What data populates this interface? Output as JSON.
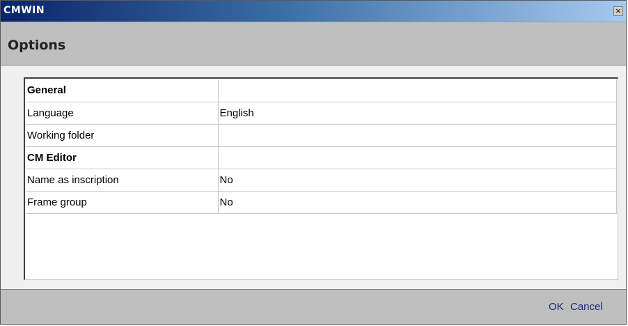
{
  "window": {
    "title": "CMWIN",
    "close_glyph": "×"
  },
  "header": {
    "title": "Options"
  },
  "grid": {
    "rows": [
      {
        "name": "General",
        "value": "",
        "section": true
      },
      {
        "name": "Language",
        "value": "English",
        "section": false
      },
      {
        "name": "Working folder",
        "value": "",
        "section": false
      },
      {
        "name": "CM Editor",
        "value": "",
        "section": true
      },
      {
        "name": "Name as inscription",
        "value": "No",
        "section": false
      },
      {
        "name": "Frame group",
        "value": "No",
        "section": false
      }
    ]
  },
  "footer": {
    "ok_label": "OK",
    "cancel_label": "Cancel"
  },
  "colors": {
    "titlebar_start": "#0a246a",
    "titlebar_end": "#a6caf0",
    "header_bg": "#bfbfbf",
    "button_text": "#1c2a6e"
  }
}
